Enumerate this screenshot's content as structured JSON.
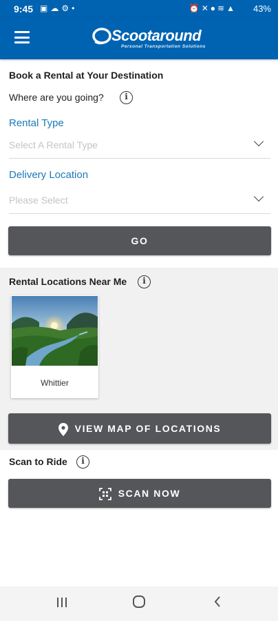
{
  "status_bar": {
    "time": "9:45",
    "left_icons": [
      "image-icon",
      "cloud-icon",
      "gear-icon",
      "dot-icon"
    ],
    "right_icons": [
      "alarm-icon",
      "mute-icon",
      "location-icon",
      "wifi-icon",
      "signal-icon"
    ],
    "battery": "43%"
  },
  "header": {
    "brand": "Scootaround",
    "tagline": "Personal Transportation Solutions",
    "menu_icon": "hamburger-icon",
    "color": "#0063b2"
  },
  "booking": {
    "title": "Book a Rental at Your Destination",
    "question": "Where are you going?",
    "rental_type": {
      "label": "Rental Type",
      "placeholder": "Select A Rental Type"
    },
    "delivery_location": {
      "label": "Delivery Location",
      "placeholder": "Please Select"
    },
    "go_button": "GO"
  },
  "nearby": {
    "title": "Rental Locations Near Me",
    "locations": [
      {
        "name": "Whittier",
        "image": "landscape-river-sunset"
      }
    ],
    "map_button": "VIEW MAP OF LOCATIONS"
  },
  "scan": {
    "title": "Scan to Ride",
    "button": "SCAN NOW"
  },
  "colors": {
    "accent_label": "#1b7ab8",
    "button_bg": "#555659"
  }
}
